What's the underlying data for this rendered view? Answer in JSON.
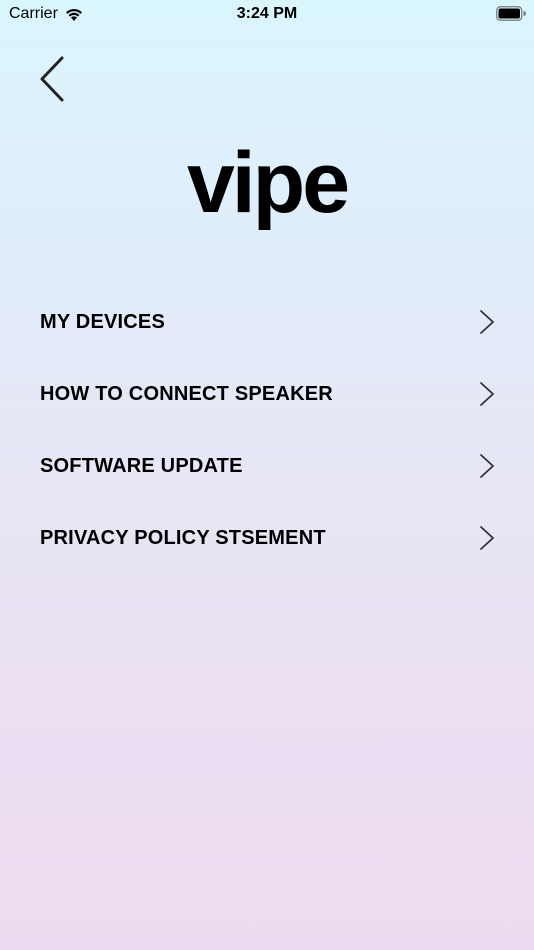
{
  "status_bar": {
    "carrier": "Carrier",
    "time": "3:24 PM",
    "wifi_icon": "wifi-icon",
    "battery_icon": "battery-icon"
  },
  "header": {
    "back_icon": "chevron-left-icon"
  },
  "logo": {
    "text": "vipe"
  },
  "menu": {
    "items": [
      {
        "label": "MY DEVICES",
        "icon": "chevron-right-icon"
      },
      {
        "label": "HOW TO CONNECT SPEAKER",
        "icon": "chevron-right-icon"
      },
      {
        "label": "SOFTWARE UPDATE",
        "icon": "chevron-right-icon"
      },
      {
        "label": "PRIVACY POLICY STSEMENT",
        "icon": "chevron-right-icon"
      }
    ]
  },
  "colors": {
    "background_top": "#daf6fd",
    "background_bottom": "#ecdbf0",
    "text": "#000000",
    "chevron": "#333333"
  }
}
